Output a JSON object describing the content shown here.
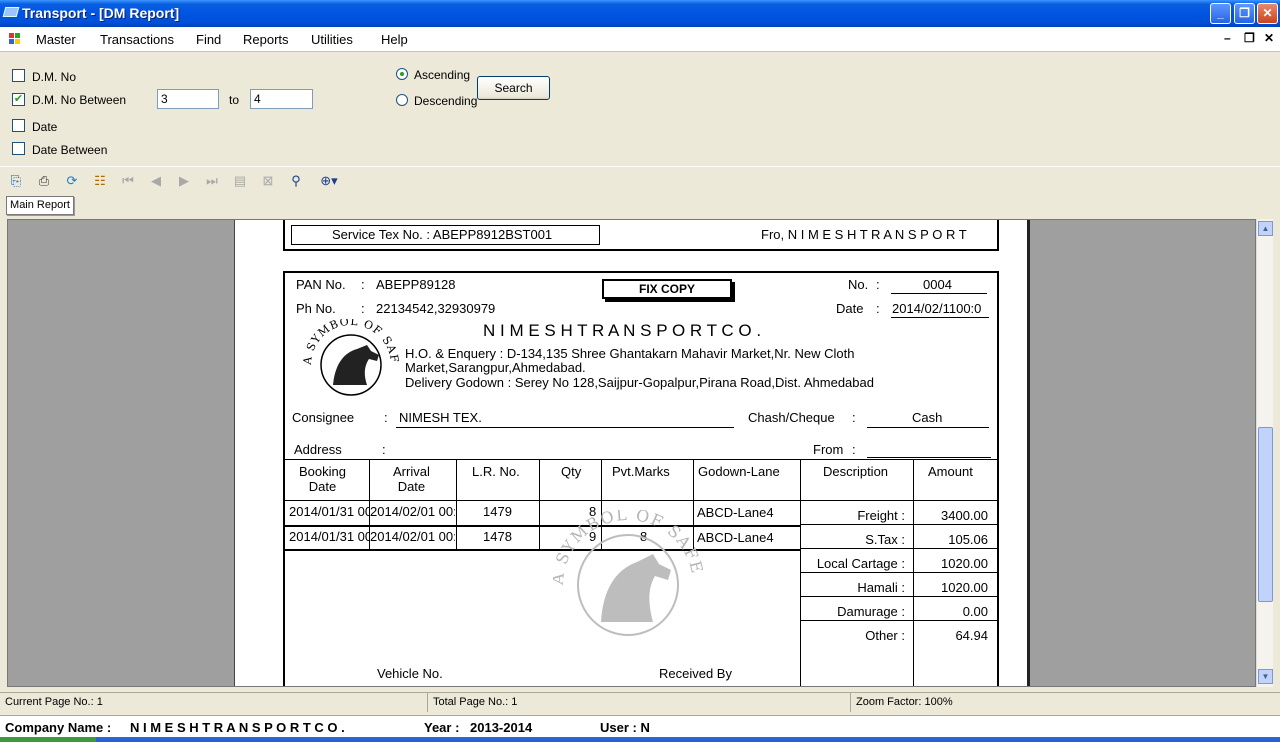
{
  "window": {
    "title": "Transport - [DM Report]"
  },
  "menu": {
    "items": [
      "Master",
      "Transactions",
      "Find",
      "Reports",
      "Utilities",
      "Help"
    ]
  },
  "filter": {
    "dm_no_label": "D.M. No",
    "dm_between_label": "D.M. No Between",
    "dm_between_checked": true,
    "from_value": "3",
    "to_label": "to",
    "to_value": "4",
    "date_label": "Date",
    "date_between_label": "Date Between",
    "ascending_label": "Ascending",
    "descending_label": "Descending",
    "sort_order": "Ascending",
    "search_label": "Search"
  },
  "viewer": {
    "tab_label": "Main Report"
  },
  "report": {
    "service_tax": "Service Tex No. : ABEPP8912BST001",
    "from_company": "Fro, N I M E S H   T R A N S P O R T",
    "pan_label": "PAN No.",
    "pan_value": "ABEPP89128",
    "ph_label": "Ph No.",
    "ph_value": "22134542,32930979",
    "fix_copy": "FIX COPY",
    "no_label": "No.",
    "no_value": "0004",
    "date_label": "Date",
    "date_value": "2014/02/1100:0",
    "logo_text": "A SYMBOL OF SAFE SERVICES",
    "company_name": "N I M E S H   T R A N S P O R T   C O .",
    "address_line1": "H.O. & Enquery : D-134,135 Shree Ghantakarn Mahavir Market,Nr. New Cloth",
    "address_line2": "Market,Sarangpur,Ahmedabad.",
    "address_line3": "Delivery Godown : Serey No 128,Saijpur-Gopalpur,Pirana Road,Dist. Ahmedabad",
    "consignee_label": "Consignee",
    "consignee_value": "NIMESH TEX.",
    "cheque_label": "Chash/Cheque",
    "cheque_value": "Cash",
    "address_label": "Address",
    "from_label": "From",
    "colon": ":",
    "table_headers": [
      "Booking\nDate",
      "Arrival\nDate",
      "L.R. No.",
      "Qty",
      "Pvt.Marks",
      "Godown-Lane",
      "Description",
      "Amount"
    ],
    "rows": [
      {
        "booking": "2014/01/31 00",
        "arrival": "2014/02/01 00:0",
        "lr": "1479",
        "qty": "8",
        "marks": "",
        "godown": "ABCD-Lane4"
      },
      {
        "booking": "2014/01/31 00",
        "arrival": "2014/02/01 00:0",
        "lr": "1478",
        "qty": "9",
        "marks": "8",
        "godown": "ABCD-Lane4"
      }
    ],
    "charges": [
      {
        "label": "Freight :",
        "amount": "3400.00"
      },
      {
        "label": "S.Tax :",
        "amount": "105.06"
      },
      {
        "label": "Local Cartage :",
        "amount": "1020.00"
      },
      {
        "label": "Hamali :",
        "amount": "1020.00"
      },
      {
        "label": "Damurage :",
        "amount": "0.00"
      },
      {
        "label": "Other :",
        "amount": "64.94"
      }
    ],
    "vehicle_label": "Vehicle No.",
    "received_label": "Received By"
  },
  "status": {
    "current_page": "Current Page No.: 1",
    "total_page": "Total Page No.: 1",
    "zoom": "Zoom Factor: 100%"
  },
  "footer": {
    "company_label": "Company Name :",
    "company_value": "N I M E S H   T R A N S P O R T   C O .",
    "year_label": "Year :",
    "year_value": "2013-2014",
    "user_label": "User : N"
  }
}
